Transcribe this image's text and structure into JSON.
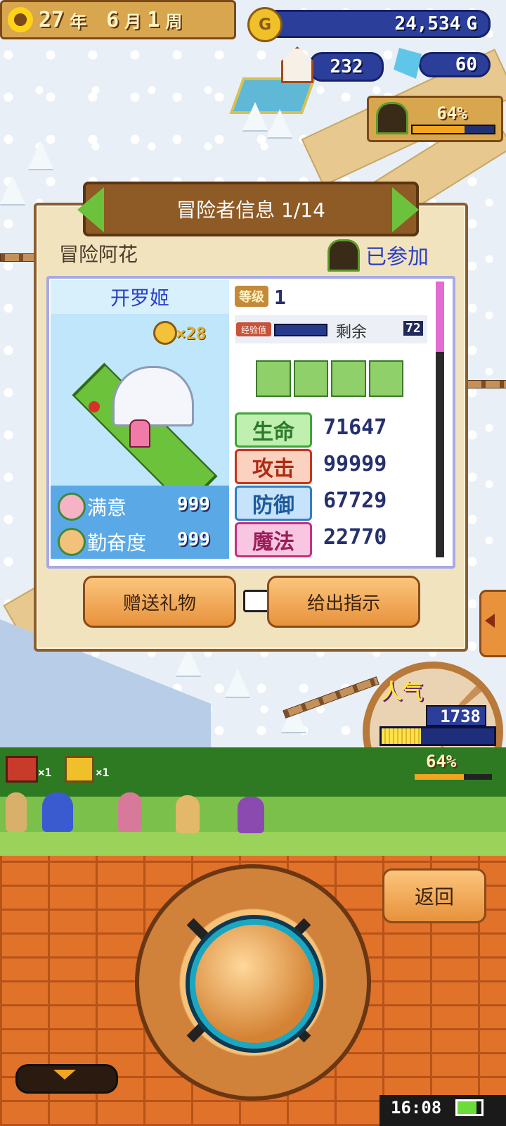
{
  "hud": {
    "year": "27",
    "year_unit": "年",
    "month": "6",
    "month_unit": "月",
    "week": "1",
    "week_unit": "周",
    "gold": "24,534",
    "gold_unit": "G",
    "coin_symbol": "G",
    "houses": "232",
    "crystals": "60",
    "dungeon_percent": "64%"
  },
  "dialog": {
    "title": "冒险者信息 1/14",
    "adventurer_name": "冒险阿花",
    "status": "已参加",
    "job": "开罗姬",
    "medal_count": "×28",
    "level_label": "等级",
    "level": "1",
    "exp_label": "经验值",
    "remaining_label": "剩余",
    "remaining_value": "72",
    "satisfaction_label": "满意",
    "satisfaction": "999",
    "diligence_label": "勤奋度",
    "diligence": "999",
    "stats": [
      {
        "label": "生命",
        "value": "71647",
        "color": "#3fa43a"
      },
      {
        "label": "攻击",
        "value": "99999",
        "color": "#c8351b"
      },
      {
        "label": "防御",
        "value": "67729",
        "color": "#2f7fc7"
      },
      {
        "label": "魔法",
        "value": "22770",
        "color": "#c6307f"
      }
    ],
    "gift_button": "赠送礼物",
    "instruct_button": "给出指示"
  },
  "popularity": {
    "label": "人气",
    "value": "1738",
    "fill": 0.35
  },
  "party": {
    "chest_red_count": "×1",
    "chest_gold_count": "×1",
    "progress_percent": "64%"
  },
  "back_button": "返回",
  "status_bar": {
    "time": "16:08"
  }
}
